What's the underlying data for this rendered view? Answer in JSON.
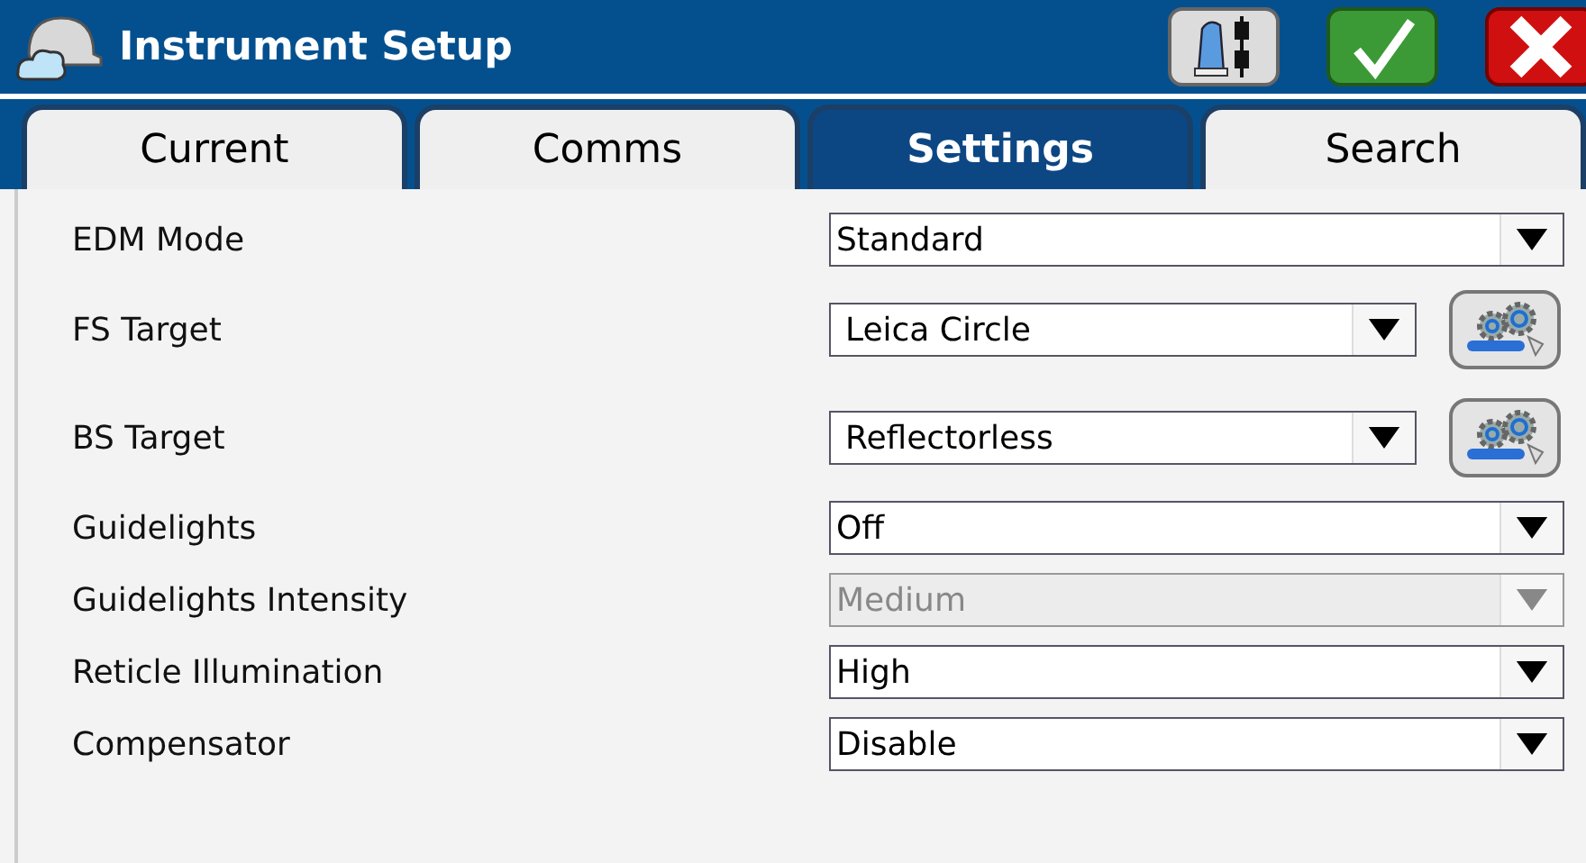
{
  "window": {
    "title": "Instrument Setup"
  },
  "tabs": [
    {
      "label": "Current",
      "selected": false
    },
    {
      "label": "Comms",
      "selected": false
    },
    {
      "label": "Settings",
      "selected": true
    },
    {
      "label": "Search",
      "selected": false
    }
  ],
  "settings": [
    {
      "kind": "select",
      "label": "EDM Mode",
      "value": "Standard",
      "disabled": false
    },
    {
      "kind": "select_with_button",
      "label": "FS Target",
      "value": "Leica Circle",
      "disabled": false
    },
    {
      "kind": "select_with_button",
      "label": "BS Target",
      "value": "Reflectorless",
      "disabled": false
    },
    {
      "kind": "select",
      "label": "Guidelights",
      "value": "Off",
      "disabled": false
    },
    {
      "kind": "select",
      "label": "Guidelights Intensity",
      "value": "Medium",
      "disabled": true
    },
    {
      "kind": "select",
      "label": "Reticle Illumination",
      "value": "High",
      "disabled": false
    },
    {
      "kind": "select",
      "label": "Compensator",
      "value": "Disable",
      "disabled": false
    }
  ]
}
